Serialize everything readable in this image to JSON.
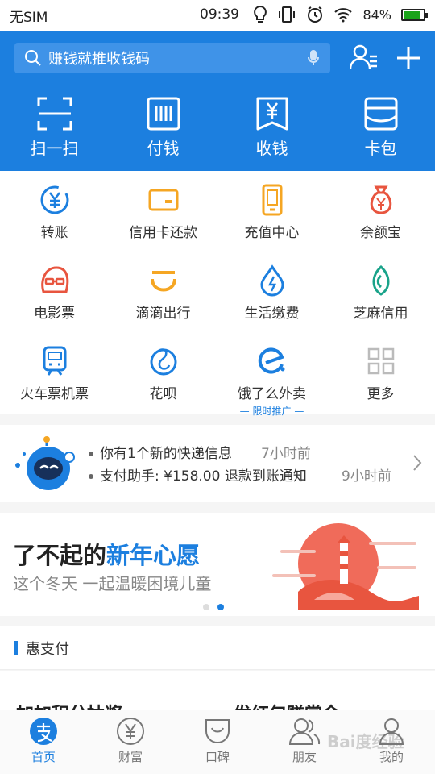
{
  "status_bar": {
    "carrier": "无SIM",
    "time": "09:39",
    "battery": "84%",
    "battery_level": 0.84
  },
  "header": {
    "search_placeholder": "赚钱就推收钱码",
    "big_actions": [
      {
        "label": "扫一扫",
        "icon": "scan-icon"
      },
      {
        "label": "付钱",
        "icon": "barcode-icon"
      },
      {
        "label": "收钱",
        "icon": "yen-receive-icon"
      },
      {
        "label": "卡包",
        "icon": "card-wallet-icon"
      }
    ]
  },
  "services": [
    {
      "label": "转账",
      "icon": "transfer-icon"
    },
    {
      "label": "信用卡还款",
      "icon": "credit-card-icon"
    },
    {
      "label": "充值中心",
      "icon": "phone-recharge-icon"
    },
    {
      "label": "余额宝",
      "icon": "money-bag-icon"
    },
    {
      "label": "电影票",
      "icon": "movie-glasses-icon"
    },
    {
      "label": "滴滴出行",
      "icon": "didi-icon"
    },
    {
      "label": "生活缴费",
      "icon": "utility-drop-icon"
    },
    {
      "label": "芝麻信用",
      "icon": "sesame-icon"
    },
    {
      "label": "火车票机票",
      "icon": "train-icon"
    },
    {
      "label": "花呗",
      "icon": "huabei-icon"
    },
    {
      "label": "饿了么外卖",
      "icon": "eleme-icon",
      "tag": "限时推广"
    },
    {
      "label": "更多",
      "icon": "more-grid-icon"
    }
  ],
  "notice": {
    "line1": "你有1个新的快递信息",
    "time1": "7小时前",
    "line2": "支付助手: ¥158.00 退款到账通知",
    "time2": "9小时前"
  },
  "banner": {
    "title_prefix": "了不起的",
    "title_accent": "新年心愿",
    "subtitle": "这个冬天 一起温暖困境儿童"
  },
  "section": {
    "title": "惠支付"
  },
  "teasers": {
    "left": "加加积分抽奖",
    "right": "发红包赚赏金"
  },
  "tabs": [
    {
      "label": "首页",
      "icon": "home-alipay-icon",
      "active": true
    },
    {
      "label": "财富",
      "icon": "wealth-yen-icon",
      "active": false
    },
    {
      "label": "口碑",
      "icon": "koubei-icon",
      "active": false
    },
    {
      "label": "朋友",
      "icon": "friends-icon",
      "active": false
    },
    {
      "label": "我的",
      "icon": "profile-icon",
      "active": false
    }
  ],
  "colors": {
    "brand_blue": "#1c7fdf",
    "orange": "#f5a623",
    "red": "#e8553f",
    "teal": "#1aa38a"
  },
  "watermark": "Bai度经验"
}
